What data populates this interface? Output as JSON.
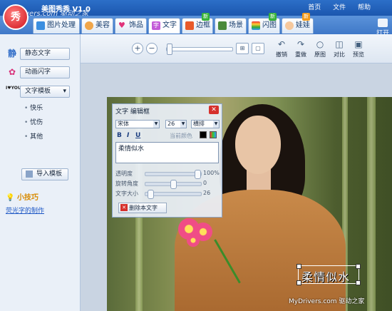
{
  "app": {
    "logo_text": "秀",
    "title": "美图秀秀 V1.0",
    "watermark_top": "MyDrivers.com 驱动之家"
  },
  "top_menu": [
    "首页",
    "文件",
    "帮助"
  ],
  "open_button": "打开",
  "tabs": [
    {
      "label": "图片处理",
      "icon": "picture-icon",
      "new": false
    },
    {
      "label": "美容",
      "icon": "face-icon",
      "new": false
    },
    {
      "label": "饰品",
      "icon": "heart-icon",
      "new": false
    },
    {
      "label": "文字",
      "icon": "text-icon",
      "new": false,
      "active": true
    },
    {
      "label": "边框",
      "icon": "frame-icon",
      "new": true
    },
    {
      "label": "场景",
      "icon": "scene-icon",
      "new": false
    },
    {
      "label": "闪图",
      "icon": "flash-icon",
      "new": true
    },
    {
      "label": "娃娃",
      "icon": "doll-icon",
      "new": true
    }
  ],
  "new_badge": "新",
  "sidebar": {
    "static_text_icon": "静",
    "static_text": "静态文字",
    "animated_text": "动画闪字",
    "template_icon": "I♥YOU",
    "template_select": "文字模板",
    "template_items": [
      "快乐",
      "忧伤",
      "其他"
    ],
    "import_button": "导入模板",
    "tip_title": "小技巧",
    "tip_link": "荧光字的制作"
  },
  "toolbar": {
    "undo": "撤销",
    "redo": "重做",
    "original": "原图",
    "compare": "对比",
    "preview": "预览",
    "zoom_in_icon": "zoom-in-icon",
    "zoom_out_icon": "zoom-out-icon"
  },
  "dialog": {
    "title": "文字 编辑框",
    "font_name": "宋体",
    "font_size": "26",
    "orientation": "横排",
    "bold": "B",
    "italic": "I",
    "underline": "U",
    "current_color_label": "当前颜色",
    "text": "柔情似水",
    "transparency_label": "透明度",
    "transparency_value": "100%",
    "transparency_level": 1.0,
    "rotation_label": "旋转角度",
    "rotation_value": "0",
    "rotation_level": 0.5,
    "size_label": "文字大小",
    "size_value": "26",
    "size_level": 0.05,
    "delete_button": "删除本文字"
  },
  "canvas_text": "柔情似水",
  "watermark_bottom": "MyDrivers.com 驱动之家",
  "colors": {
    "title_blue": "#1b56ae",
    "accent_red": "#d6312c",
    "text_color_swatch": "#000000"
  }
}
